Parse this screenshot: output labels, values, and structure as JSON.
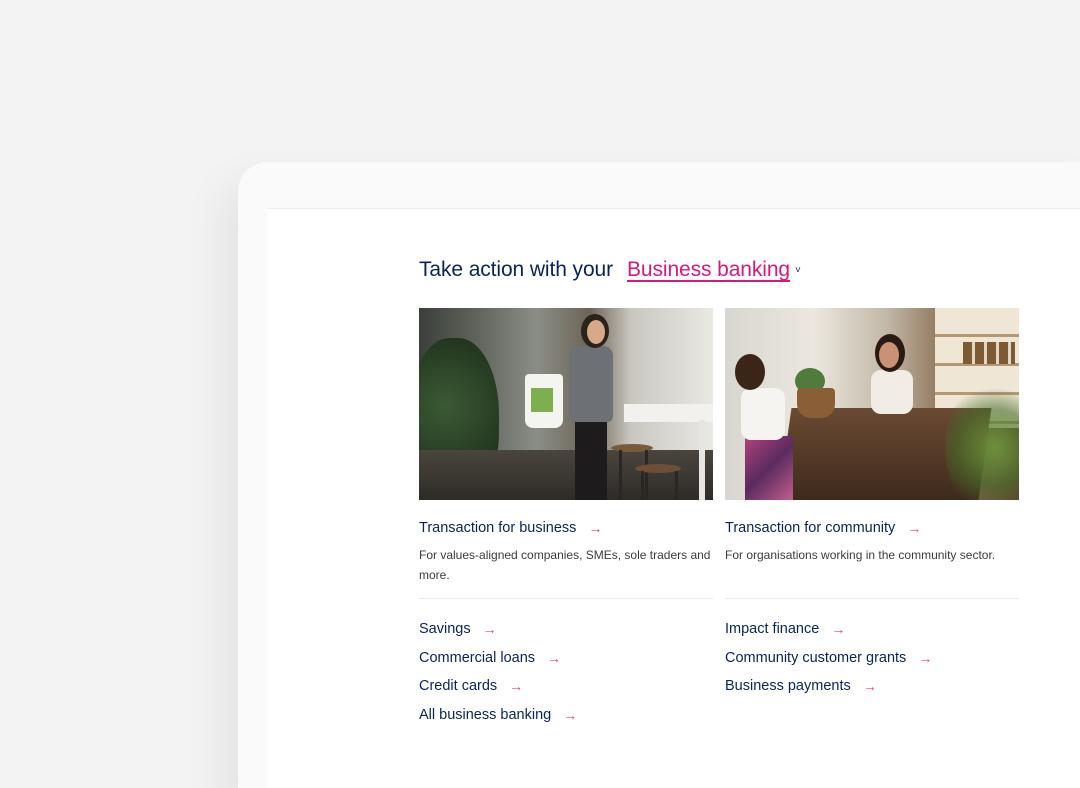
{
  "heading": {
    "prefix": "Take action with your",
    "selector": "Business banking",
    "caret": "˅"
  },
  "columns": [
    {
      "main_link": "Transaction for business",
      "description": "For values-aligned companies, SMEs, sole traders and more.",
      "links": [
        "Savings",
        "Commercial loans",
        "Credit cards",
        "All business banking"
      ]
    },
    {
      "main_link": "Transaction for community",
      "description": "For organisations working in the community sector.",
      "links": [
        "Impact finance",
        "Community customer grants",
        "Business payments"
      ]
    }
  ],
  "arrow": "→",
  "colors": {
    "navy": "#0b2456",
    "accent_pink": "#d6197e",
    "arrow_red": "#e8456b"
  }
}
